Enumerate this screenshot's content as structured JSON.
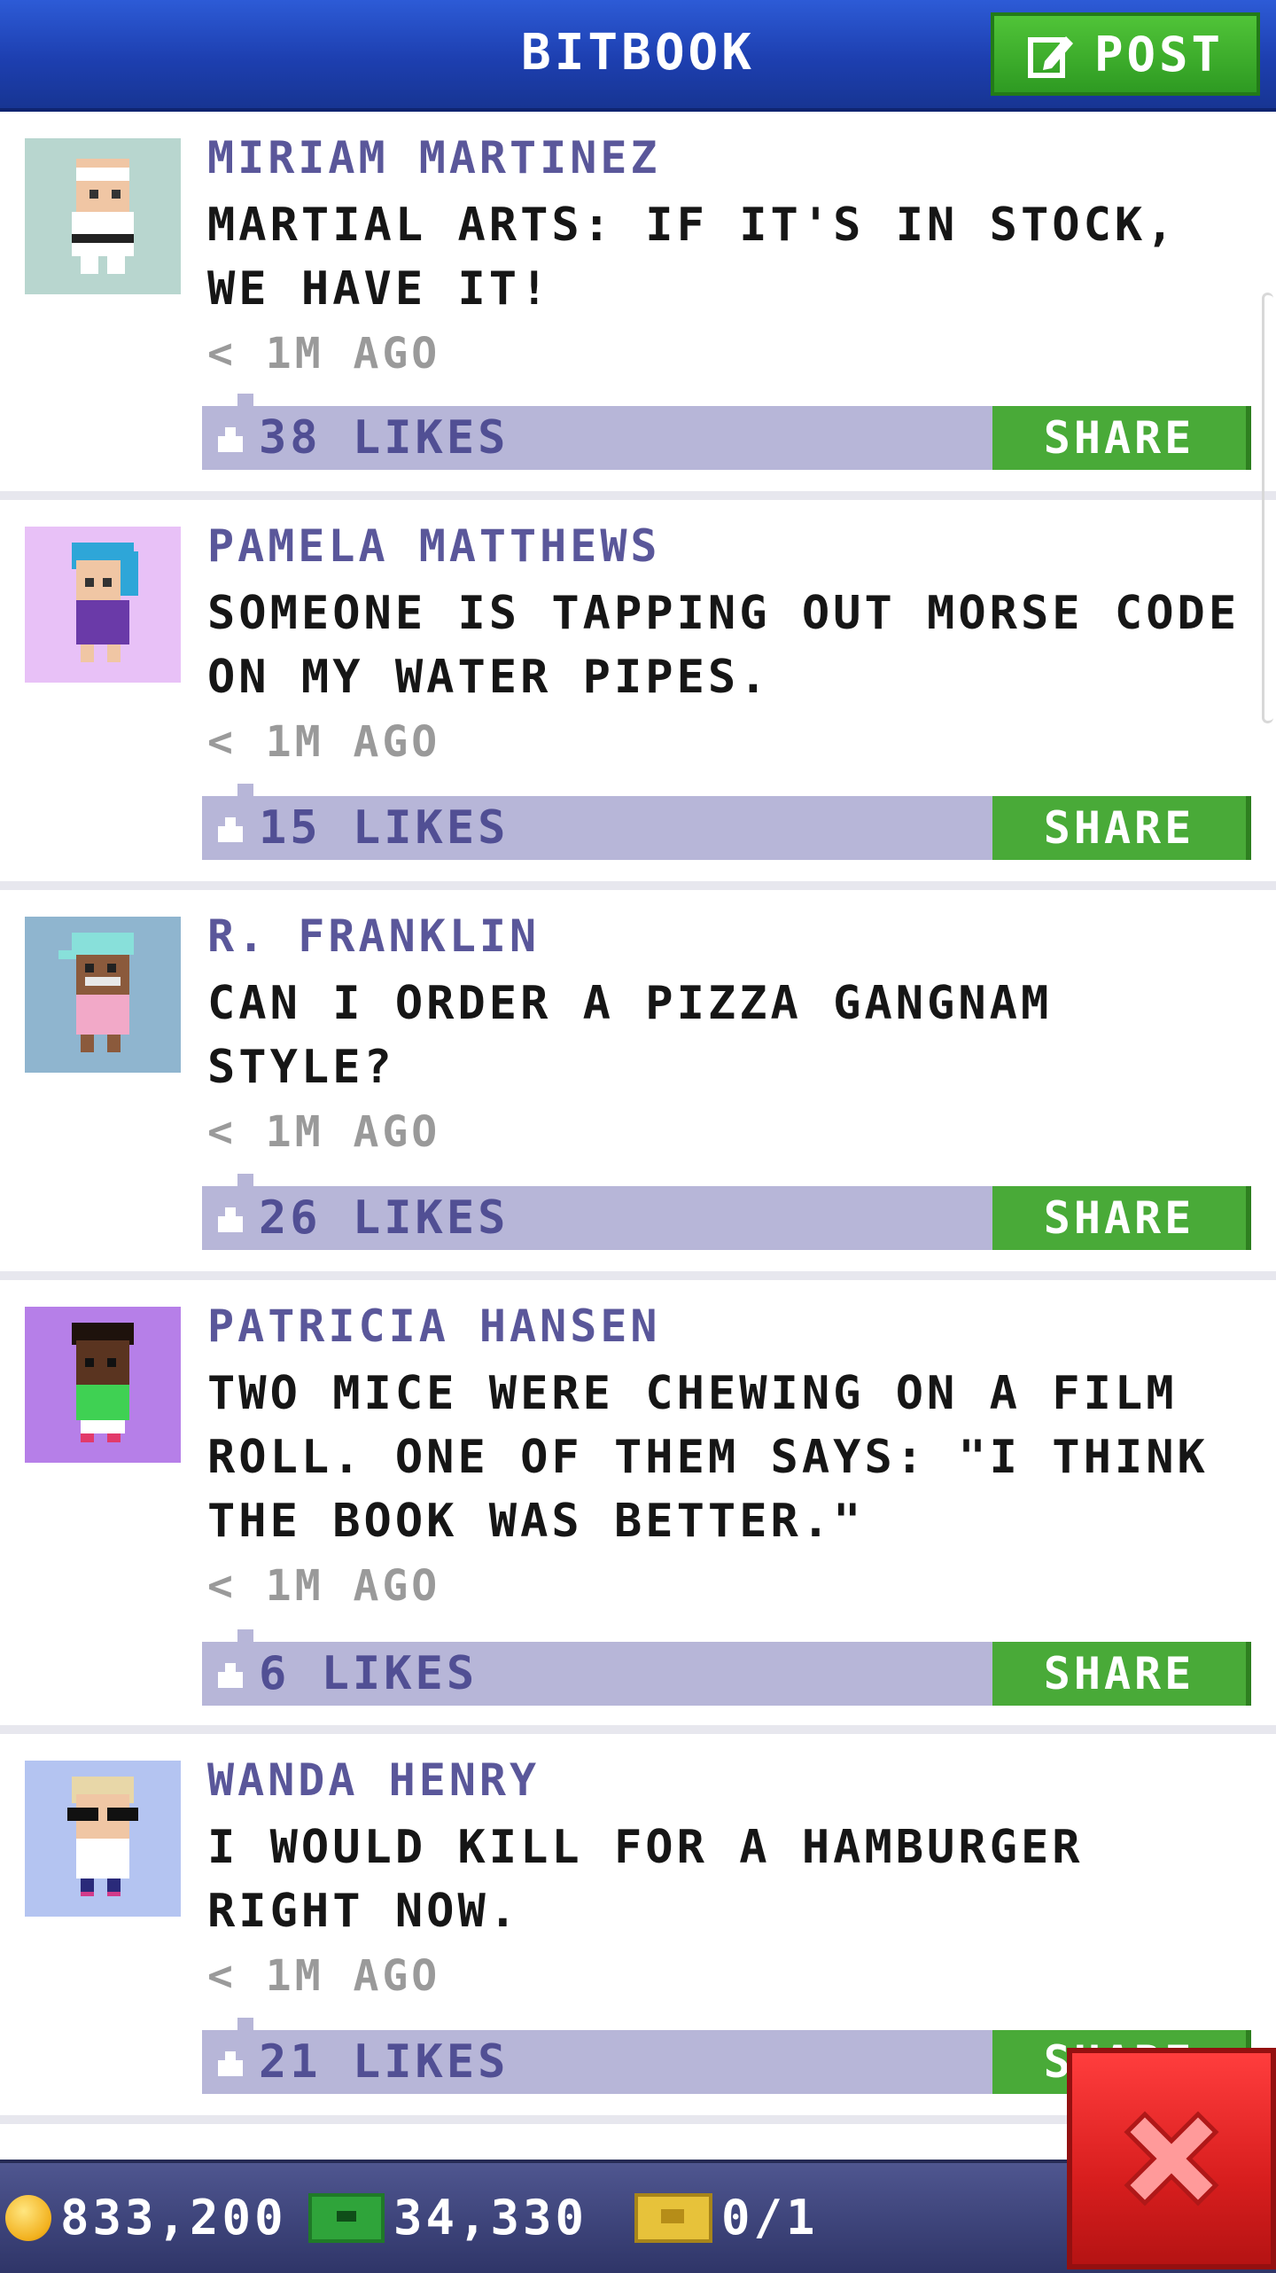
{
  "header": {
    "title": "BITBOOK",
    "post_button": "POST",
    "colors": {
      "bar": "#1d3fb0",
      "post": "#3aad2a"
    }
  },
  "feed": {
    "share_label": "SHARE",
    "posts": [
      {
        "author": "MIRIAM MARTINEZ",
        "message": "MARTIAL ARTS: IF IT'S IN STOCK, WE HAVE IT!",
        "time": "< 1M AGO",
        "likes": "38 LIKES",
        "avatar_bg": "#b8d6cf",
        "avatar_icon": "karate-person-icon"
      },
      {
        "author": "PAMELA MATTHEWS",
        "message": "SOMEONE IS TAPPING OUT MORSE CODE ON MY WATER PIPES.",
        "time": "< 1M AGO",
        "likes": "15 LIKES",
        "avatar_bg": "#e8c1f7",
        "avatar_icon": "blue-hair-person-icon"
      },
      {
        "author": "R. FRANKLIN",
        "message": "CAN I ORDER A PIZZA GANGNAM STYLE?",
        "time": "< 1M AGO",
        "likes": "26 LIKES",
        "avatar_bg": "#8fb5cf",
        "avatar_icon": "cap-person-icon"
      },
      {
        "author": "PATRICIA HANSEN",
        "message": "TWO MICE WERE CHEWING ON A FILM ROLL. ONE OF THEM SAYS: \"I THINK THE BOOK WAS BETTER.\"",
        "time": "< 1M AGO",
        "likes": "6 LIKES",
        "avatar_bg": "#b67fe8",
        "avatar_icon": "green-shirt-person-icon"
      },
      {
        "author": "WANDA HENRY",
        "message": "I WOULD KILL FOR A HAMBURGER RIGHT NOW.",
        "time": "< 1M AGO",
        "likes": "21 LIKES",
        "avatar_bg": "#b4c4f1",
        "avatar_icon": "sunglasses-person-icon"
      }
    ]
  },
  "status": {
    "coins": "833,200",
    "bux": "34,330",
    "tickets": "0/1"
  }
}
